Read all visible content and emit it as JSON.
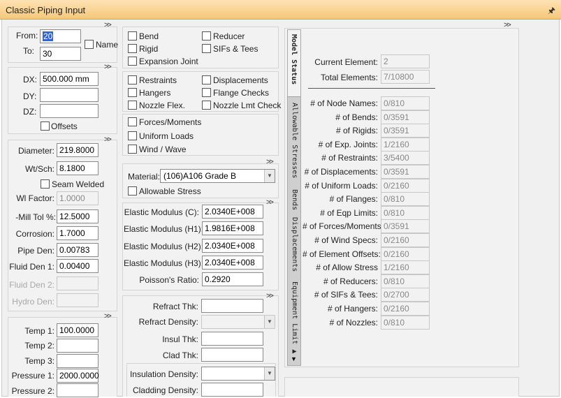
{
  "window": {
    "title": "Classic Piping Input",
    "pin_icon": "pin-icon"
  },
  "element": {
    "from_label": "From:",
    "from_value": "20",
    "to_label": "To:",
    "to_value": "30",
    "name_label": "Name"
  },
  "geometry": {
    "dx_label": "DX:",
    "dx_value": "500.000 mm",
    "dy_label": "DY:",
    "dy_value": "",
    "dz_label": "DZ:",
    "dz_value": "",
    "offsets_label": "Offsets"
  },
  "pipe": {
    "diameter_label": "Diameter:",
    "diameter_value": "219.8000",
    "wtsch_label": "Wt/Sch:",
    "wtsch_value": "8.1800",
    "seam_welded_label": "Seam Welded",
    "wl_factor_label": "Wl Factor:",
    "wl_factor_value": "1.0000",
    "mill_tol_label": "-Mill Tol %:",
    "mill_tol_value": "12.5000",
    "corrosion_label": "Corrosion:",
    "corrosion_value": "1.7000",
    "pipe_den_label": "Pipe Den:",
    "pipe_den_value": "0.00783",
    "fluid_den1_label": "Fluid Den 1:",
    "fluid_den1_value": "0.00400",
    "fluid_den2_label": "Fluid Den 2:",
    "fluid_den2_value": "",
    "hydro_den_label": "Hydro Den:",
    "hydro_den_value": ""
  },
  "operating": {
    "temp1_label": "Temp 1:",
    "temp1_value": "100.0000",
    "temp2_label": "Temp 2:",
    "temp2_value": "",
    "temp3_label": "Temp 3:",
    "temp3_value": "",
    "pressure1_label": "Pressure 1:",
    "pressure1_value": "2000.0000",
    "pressure2_label": "Pressure 2:",
    "pressure2_value": ""
  },
  "element_types": {
    "bend": "Bend",
    "reducer": "Reducer",
    "rigid": "Rigid",
    "sifs_tees": "SIFs & Tees",
    "expansion_joint": "Expansion Joint"
  },
  "aux": {
    "restraints": "Restraints",
    "displacements": "Displacements",
    "hangers": "Hangers",
    "flange_checks": "Flange Checks",
    "nozzle_flex": "Nozzle Flex.",
    "nozzle_lmt_check": "Nozzle Lmt Check"
  },
  "loads": {
    "forces_moments": "Forces/Moments",
    "uniform_loads": "Uniform Loads",
    "wind_wave": "Wind / Wave"
  },
  "material": {
    "material_label": "Material:",
    "material_value": "(106)A106 Grade B",
    "allowable_stress_label": "Allowable Stress"
  },
  "elastic": {
    "ec_label": "Elastic Modulus (C):",
    "ec_value": "2.0340E+008",
    "eh1_label": "Elastic Modulus (H1):",
    "eh1_value": "1.9816E+008",
    "eh2_label": "Elastic Modulus (H2):",
    "eh2_value": "2.0340E+008",
    "eh3_label": "Elastic Modulus (H3):",
    "eh3_value": "2.0340E+008",
    "poisson_label": "Poisson's Ratio:",
    "poisson_value": "0.2920"
  },
  "insulation": {
    "refract_thk_label": "Refract Thk:",
    "refract_thk_value": "",
    "refract_density_label": "Refract Density:",
    "refract_density_value": "",
    "insul_thk_label": "Insul Thk:",
    "insul_thk_value": "",
    "clad_thk_label": "Clad Thk:",
    "clad_thk_value": "",
    "insulation_density_label": "Insulation Density:",
    "insulation_density_value": "",
    "cladding_density_label": "Cladding Density:",
    "cladding_density_value": ""
  },
  "tabs": [
    "Model Status",
    "Allowable Stresses",
    "Bends",
    "Displacements",
    "Equipment Limit"
  ],
  "status": {
    "current_element_label": "Current Element:",
    "current_element_value": "2",
    "total_elements_label": "Total Elements:",
    "total_elements_value": "7/10800",
    "rows": [
      {
        "label": "# of Node Names:",
        "value": "0/810"
      },
      {
        "label": "# of Bends:",
        "value": "0/3591"
      },
      {
        "label": "# of Rigids:",
        "value": "0/3591"
      },
      {
        "label": "# of Exp. Joints:",
        "value": "1/2160"
      },
      {
        "label": "# of Restraints:",
        "value": "3/5400"
      },
      {
        "label": "# of Displacements:",
        "value": "0/3591"
      },
      {
        "label": "# of Uniform Loads:",
        "value": "0/2160"
      },
      {
        "label": "# of Flanges:",
        "value": "0/810"
      },
      {
        "label": "# of Eqp Limits:",
        "value": "0/810"
      },
      {
        "label": "# of Forces/Moments:",
        "value": "0/3591"
      },
      {
        "label": "# of Wind Specs:",
        "value": "0/2160"
      },
      {
        "label": "# of Element Offsets:",
        "value": "0/2160"
      },
      {
        "label": "# of Allow Stress",
        "value": "1/2160"
      },
      {
        "label": "# of Reducers:",
        "value": "0/810"
      },
      {
        "label": "# of SIFs & Tees:",
        "value": "0/2700"
      },
      {
        "label": "# of Hangers:",
        "value": "0/2160"
      },
      {
        "label": "# of Nozzles:",
        "value": "0/810"
      }
    ]
  }
}
